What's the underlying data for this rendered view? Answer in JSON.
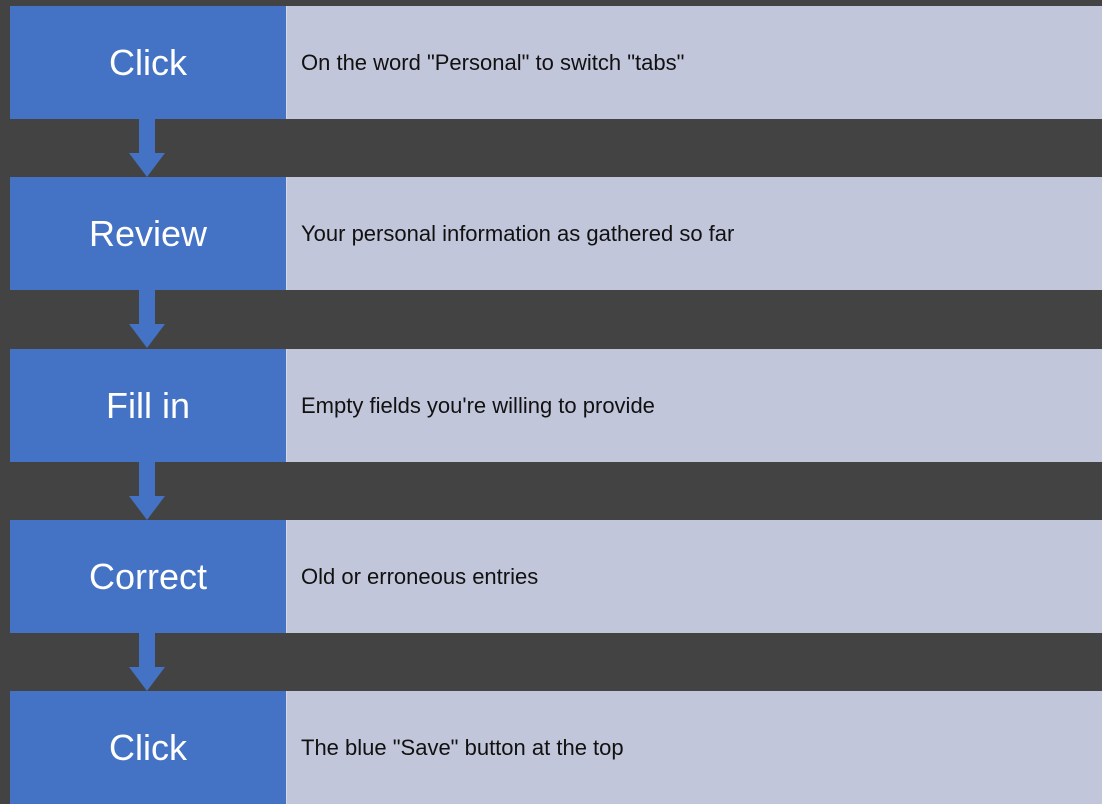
{
  "steps": [
    {
      "action": "Click",
      "description": "On the word \"Personal\" to switch \"tabs\""
    },
    {
      "action": "Review",
      "description": "Your personal information as gathered so far"
    },
    {
      "action": "Fill in",
      "description": "Empty fields you're willing to provide"
    },
    {
      "action": "Correct",
      "description": "Old or erroneous entries"
    },
    {
      "action": "Click",
      "description": "The blue \"Save\" button at the top"
    }
  ],
  "colors": {
    "background": "#434343",
    "action_box": "#4472c4",
    "description_box": "#c2c6da",
    "arrow": "#4472c4"
  }
}
